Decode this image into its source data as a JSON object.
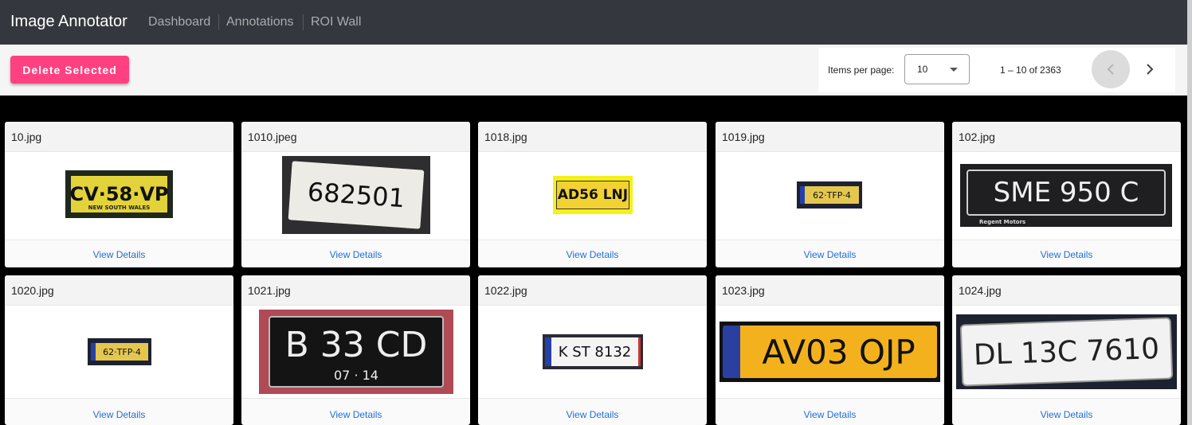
{
  "app": {
    "title": "Image Annotator"
  },
  "nav": [
    {
      "label": "Dashboard"
    },
    {
      "label": "Annotations"
    },
    {
      "label": "ROI Wall"
    }
  ],
  "toolbar": {
    "delete_label": "Delete Selected"
  },
  "paginator": {
    "items_label": "Items per page:",
    "page_size": "10",
    "range": "1 – 10 of 2363",
    "prev_icon": "chevron-left-icon",
    "next_icon": "chevron-right-icon"
  },
  "cards": [
    {
      "title": "10.jpg",
      "plate": "CV·58·VP",
      "sub": "NEW SOUTH WALES",
      "link": "View Details"
    },
    {
      "title": "1010.jpeg",
      "plate": "682501",
      "sub": "",
      "link": "View Details"
    },
    {
      "title": "1018.jpg",
      "plate": "AD56 LNJ",
      "sub": "",
      "link": "View Details"
    },
    {
      "title": "1019.jpg",
      "plate": "62·TFP·4",
      "sub": "",
      "link": "View Details"
    },
    {
      "title": "102.jpg",
      "plate": "SME 950 C",
      "sub": "Regent Motors",
      "link": "View Details"
    },
    {
      "title": "1020.jpg",
      "plate": "62·TFP·4",
      "sub": "",
      "link": "View Details"
    },
    {
      "title": "1021.jpg",
      "plate": "B 33 CD",
      "sub": "07 · 14",
      "link": "View Details"
    },
    {
      "title": "1022.jpg",
      "plate": "K ST 8132",
      "sub": "",
      "link": "View Details"
    },
    {
      "title": "1023.jpg",
      "plate": "AV03 OJP",
      "sub": "",
      "link": "View Details"
    },
    {
      "title": "1024.jpg",
      "plate": "DL 13C 7610",
      "sub": "",
      "link": "View Details"
    }
  ]
}
